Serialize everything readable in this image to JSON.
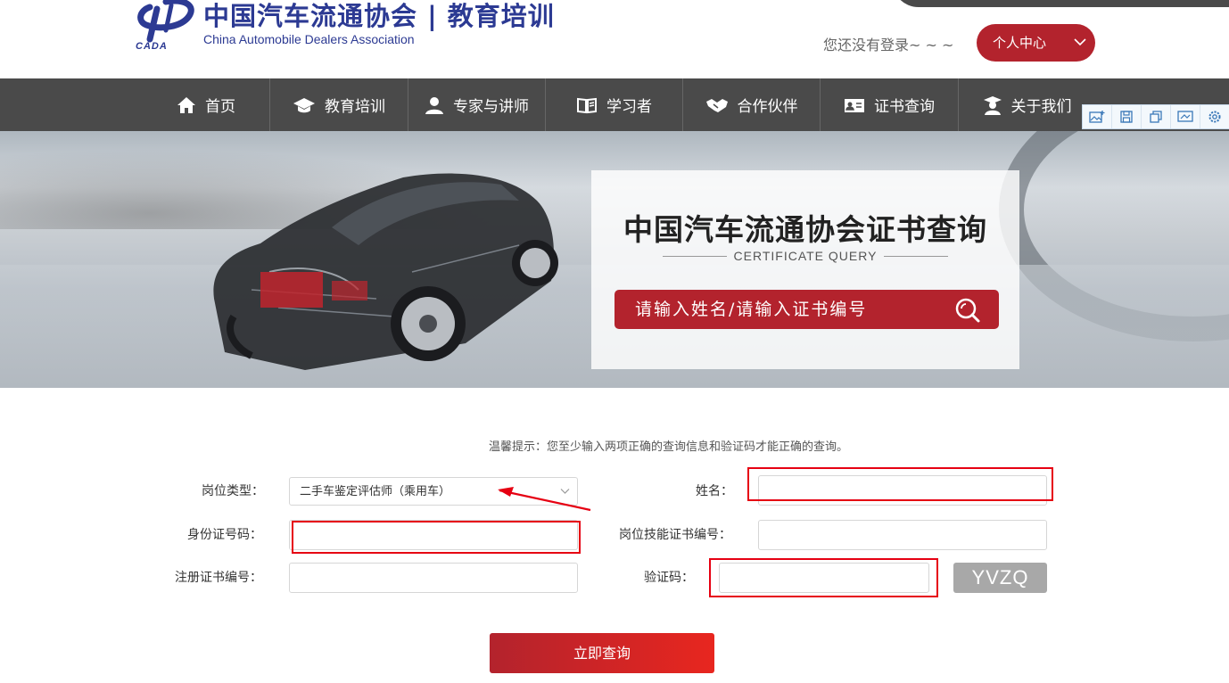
{
  "header": {
    "logo_cn": "中国汽车流通协会 | 教育培训",
    "logo_en": "China Automobile Dealers Association",
    "logo_abbr": "CADA",
    "login_hint": "您还没有登录~ ~ ~",
    "user_center": "个人中心"
  },
  "nav": {
    "items": [
      {
        "label": "首页",
        "icon": "home-icon"
      },
      {
        "label": "教育培训",
        "icon": "graduation-cap-icon"
      },
      {
        "label": "专家与讲师",
        "icon": "person-icon"
      },
      {
        "label": "学习者",
        "icon": "book-icon"
      },
      {
        "label": "合作伙伴",
        "icon": "handshake-icon"
      },
      {
        "label": "证书查询",
        "icon": "certificate-icon"
      },
      {
        "label": "关于我们",
        "icon": "graduate-person-icon"
      }
    ]
  },
  "toolbar": {
    "icons": [
      "image-add-icon",
      "save-icon",
      "copy-icon",
      "screenshot-icon",
      "settings-icon"
    ]
  },
  "banner": {
    "title": "中国汽车流通协会证书查询",
    "subtitle": "CERTIFICATE QUERY",
    "search_placeholder": "请输入姓名/请输入证书编号"
  },
  "form": {
    "tip": "温馨提示：您至少输入两项正确的查询信息和验证码才能正确的查询。",
    "position_type_label": "岗位类型：",
    "position_type_value": "二手车鉴定评估师（乘用车）",
    "name_label": "姓名：",
    "id_label": "身份证号码：",
    "skill_cert_label": "岗位技能证书编号：",
    "reg_cert_label": "注册证书编号：",
    "captcha_label": "验证码：",
    "captcha_code": "YVZQ",
    "submit": "立即查询"
  },
  "colors": {
    "brand_red": "#b3232d",
    "nav_bg": "#4a4a4a",
    "logo_blue": "#2c3a93",
    "annotation_red": "#e60012"
  }
}
